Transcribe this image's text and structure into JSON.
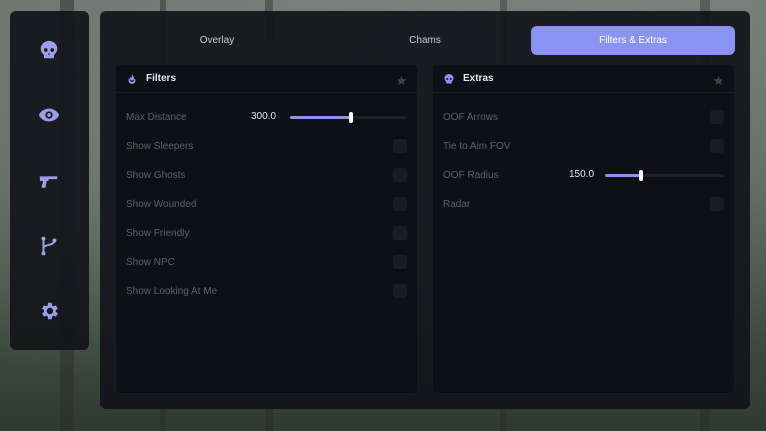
{
  "tabs": [
    {
      "label": "Overlay",
      "active": false
    },
    {
      "label": "Chams",
      "active": false
    },
    {
      "label": "Filters & Extras",
      "active": true
    }
  ],
  "sidebar": {
    "items": [
      {
        "icon": "skull-icon"
      },
      {
        "icon": "eye-icon"
      },
      {
        "icon": "pistol-icon"
      },
      {
        "icon": "branch-icon"
      },
      {
        "icon": "gear-icon"
      }
    ]
  },
  "filters": {
    "title": "Filters",
    "icon": "flame-icon",
    "max_distance": {
      "label": "Max Distance",
      "value": "300.0",
      "fraction": 0.52
    },
    "toggles": [
      {
        "label": "Show Sleepers",
        "checked": false
      },
      {
        "label": "Show Ghosts",
        "checked": false
      },
      {
        "label": "Show Wounded",
        "checked": false
      },
      {
        "label": "Show Friendly",
        "checked": false
      },
      {
        "label": "Show NPC",
        "checked": false
      },
      {
        "label": "Show Looking At Me",
        "checked": false
      }
    ]
  },
  "extras": {
    "title": "Extras",
    "icon": "skull-icon",
    "oof_arrows": {
      "label": "OOF Arrows",
      "checked": false
    },
    "tie_to_aim": {
      "label": "Tie to Aim FOV",
      "checked": false
    },
    "oof_radius": {
      "label": "OOF Radius",
      "value": "150.0",
      "fraction": 0.3
    },
    "radar": {
      "label": "Radar",
      "checked": false
    }
  },
  "colors": {
    "accent": "#8b93f2",
    "panel": "#13141a",
    "card": "#0f1016"
  }
}
